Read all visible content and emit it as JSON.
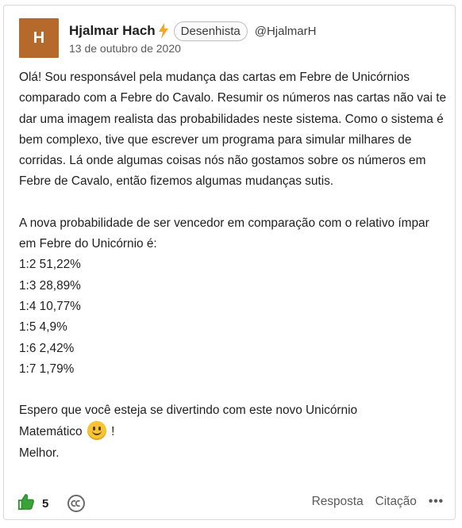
{
  "post": {
    "avatar_letter": "H",
    "author": "Hjalmar Hach",
    "role": "Desenhista",
    "handle": "@HjalmarH",
    "date": "13 de outubro de 2020",
    "paragraph1": "Olá! Sou responsável pela mudança das cartas em Febre de Unicórnios comparado com a Febre do Cavalo. Resumir os números nas cartas não vai te dar uma imagem realista das probabilidades neste sistema. Como o sistema é bem complexo, tive que escrever um programa para simular milhares de corridas. Lá onde algumas coisas nós não gostamos sobre os números em Febre de Cavalo, então fizemos algumas mudanças sutis.",
    "paragraph2_intro": "A nova probabilidade de ser vencedor em comparação com o relativo ímpar em Febre do Unicórnio é:",
    "odds": [
      "1:2 51,22%",
      "1:3 28,89%",
      "1:4 10,77%",
      "1:5 4,9%",
      "1:6 2,42%",
      "1:7 1,79%"
    ],
    "closing_line1": "Espero que você esteja se divertindo com este novo Unicórnio",
    "closing_line2_text": "Matemático",
    "closing_line2_end": "!",
    "sign_off": "Melhor.",
    "smiley_icon": "slightly-smiling-face",
    "accent_color": "#2e8b2e",
    "bolt_color": "#f5a623",
    "avatar_color": "#b56a2c"
  },
  "footer": {
    "like_count": "5",
    "reply_label": "Resposta",
    "quote_label": "Citação",
    "more_label": "•••"
  }
}
